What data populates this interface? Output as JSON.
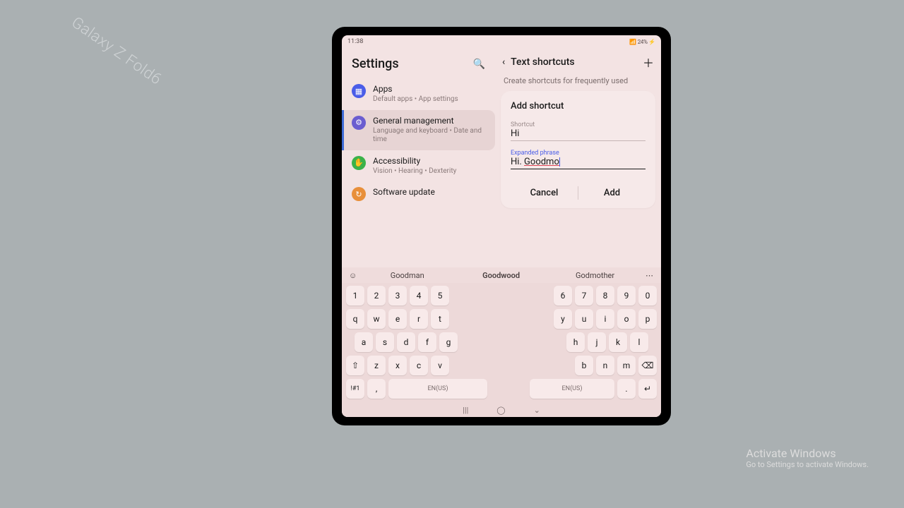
{
  "statusbar": {
    "time": "11:38",
    "right": "📶 24% ⚡"
  },
  "left": {
    "title": "Settings",
    "items": [
      {
        "label": "Apps",
        "sub": "Default apps  •  App settings"
      },
      {
        "label": "General management",
        "sub": "Language and keyboard  •  Date and time"
      },
      {
        "label": "Accessibility",
        "sub": "Vision  •  Hearing  •  Dexterity"
      },
      {
        "label": "Software update",
        "sub": ""
      }
    ]
  },
  "right": {
    "title": "Text shortcuts",
    "desc": "Create shortcuts for frequently used",
    "card": {
      "title": "Add shortcut",
      "shortcut_label": "Shortcut",
      "shortcut_value": "Hi",
      "phrase_label": "Expanded phrase",
      "phrase_prefix": "Hi. ",
      "phrase_word": "Goodmo",
      "cancel": "Cancel",
      "add": "Add"
    }
  },
  "suggestions": [
    "Goodman",
    "Goodwood",
    "Godmother"
  ],
  "keyboard": {
    "row1L": [
      "1",
      "2",
      "3",
      "4",
      "5"
    ],
    "row1R": [
      "6",
      "7",
      "8",
      "9",
      "0"
    ],
    "row2L": [
      "q",
      "w",
      "e",
      "r",
      "t"
    ],
    "row2R": [
      "y",
      "u",
      "i",
      "o",
      "p"
    ],
    "row3L": [
      "a",
      "s",
      "d",
      "f",
      "g"
    ],
    "row3R": [
      "h",
      "j",
      "k",
      "l"
    ],
    "row4L": [
      "z",
      "x",
      "c",
      "v"
    ],
    "row4R": [
      "b",
      "n",
      "m"
    ],
    "lang": "EN(US)"
  },
  "watermark": {
    "l1": "Activate Windows",
    "l2": "Go to Settings to activate Windows."
  },
  "box": "Galaxy Z Fold6"
}
